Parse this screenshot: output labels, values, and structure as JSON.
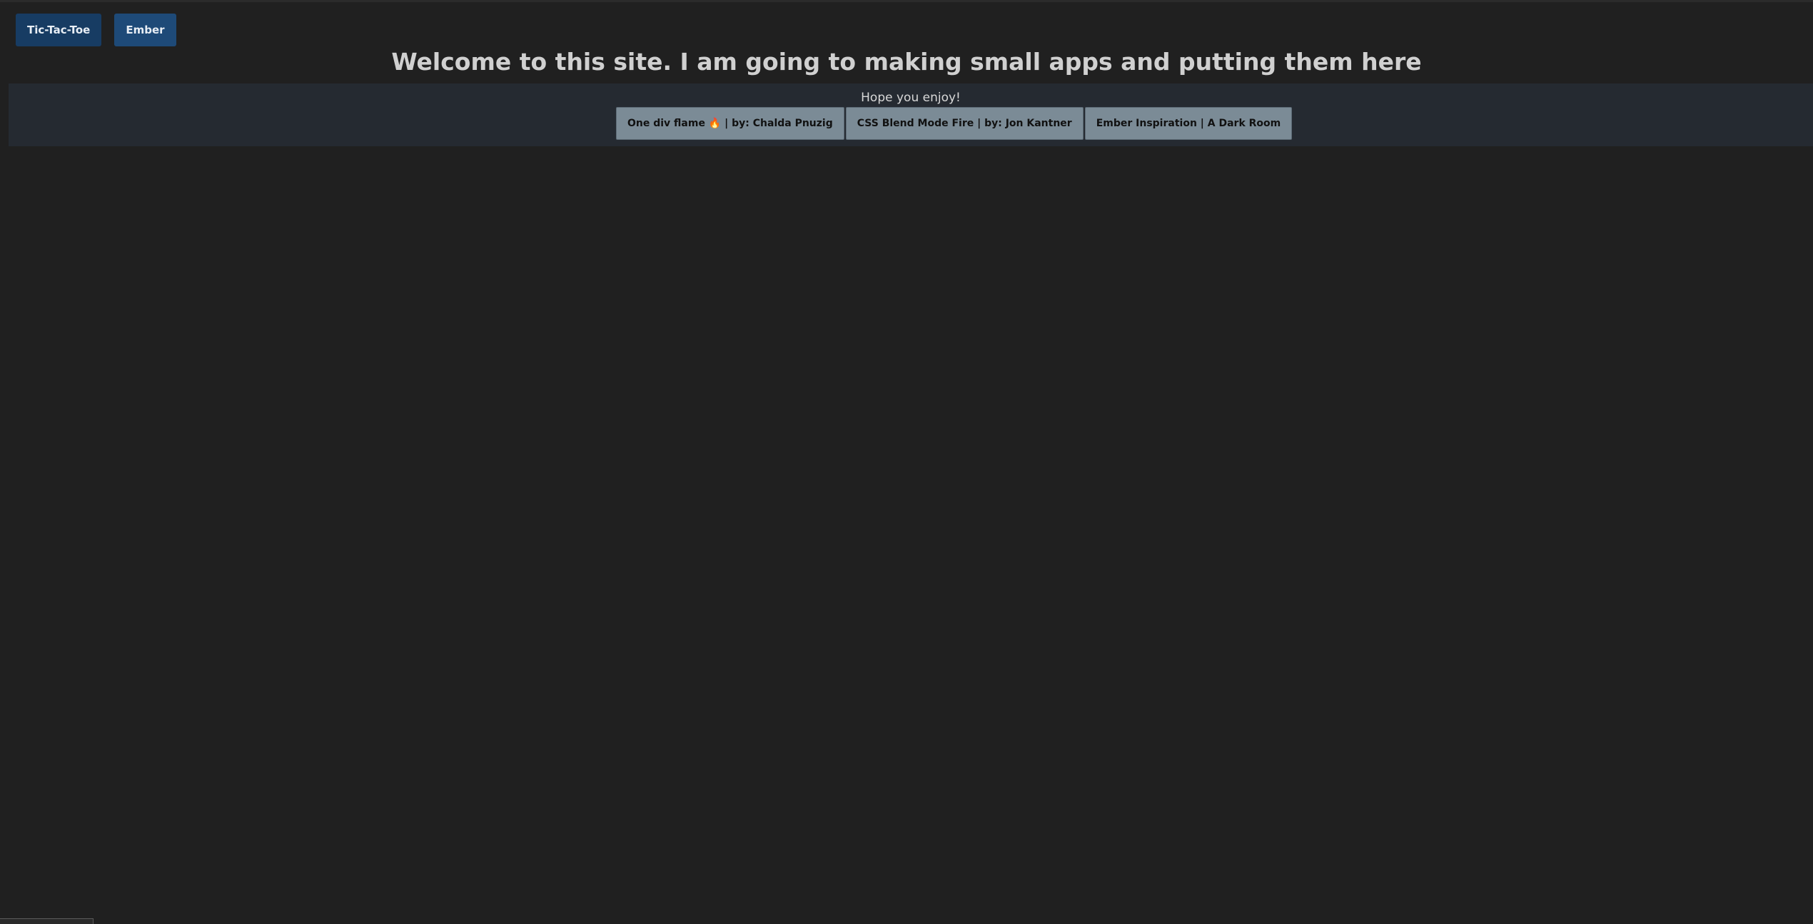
{
  "nav": {
    "buttons": [
      {
        "label": "Tic-Tac-Toe"
      },
      {
        "label": "Ember"
      }
    ]
  },
  "header": {
    "title": "Welcome to this site. I am going to making small apps and putting them here"
  },
  "panel": {
    "subtitle": "Hope you enjoy!",
    "links": [
      {
        "label": "One div flame 🔥 | by: Chalda Pnuzig"
      },
      {
        "label": "CSS Blend Mode Fire | by: Jon Kantner"
      },
      {
        "label": "Ember Inspiration | A Dark Room"
      }
    ]
  },
  "colors": {
    "background": "#202020",
    "nav_button": "#1e4a78",
    "panel": "#252a31",
    "link_button": "#7b8b96"
  }
}
